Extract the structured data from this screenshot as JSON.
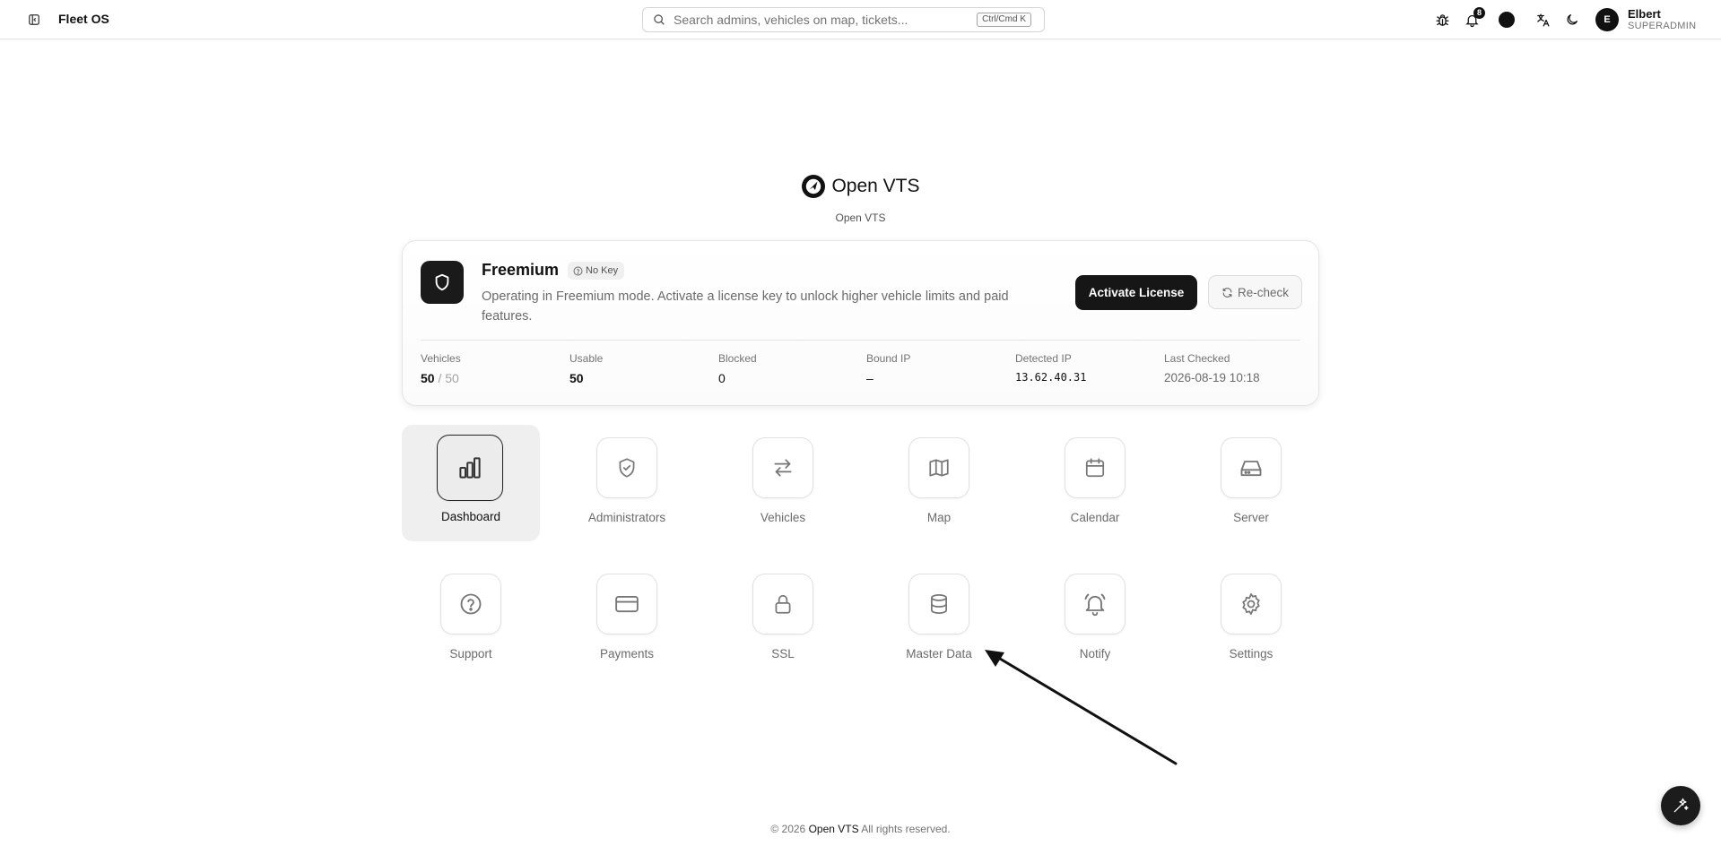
{
  "topbar": {
    "brand": "Fleet OS",
    "sidebar_toggle_icon": "panel-toggle-icon",
    "search": {
      "placeholder": "Search admins, vehicles on map, tickets...",
      "value": "",
      "shortcut": "Ctrl/Cmd K"
    },
    "icons": [
      "bug-icon",
      "bell-icon",
      "theme-color-icon",
      "translate-icon",
      "moon-icon"
    ],
    "notification_count": "8",
    "user": {
      "initial": "E",
      "name": "Elbert",
      "role": "SUPERADMIN"
    }
  },
  "logo": {
    "text": "Open VTS",
    "subtitle": "Open VTS"
  },
  "license": {
    "plan": "Freemium",
    "badge": "No Key",
    "description": "Operating in Freemium mode. Activate a license key to unlock higher vehicle limits and paid features.",
    "activate_label": "Activate License",
    "recheck_label": "Re-check",
    "stats": {
      "vehicles": {
        "label": "Vehicles",
        "value": "50",
        "separator": " / ",
        "limit": "50"
      },
      "usable": {
        "label": "Usable",
        "value": "50"
      },
      "blocked": {
        "label": "Blocked",
        "value": "0"
      },
      "bound_ip": {
        "label": "Bound IP",
        "value": "–"
      },
      "detected_ip": {
        "label": "Detected IP",
        "value": "13.62.40.31"
      },
      "last_checked": {
        "label": "Last Checked",
        "value": "2026-08-19 10:18"
      }
    }
  },
  "apps": [
    {
      "label": "Dashboard",
      "icon": "bar-chart-icon",
      "active": true
    },
    {
      "label": "Administrators",
      "icon": "shield-check-icon"
    },
    {
      "label": "Vehicles",
      "icon": "arrows-left-right-icon"
    },
    {
      "label": "Map",
      "icon": "map-icon"
    },
    {
      "label": "Calendar",
      "icon": "calendar-icon"
    },
    {
      "label": "Server",
      "icon": "hard-drive-icon"
    },
    {
      "label": "Support",
      "icon": "help-circle-icon"
    },
    {
      "label": "Payments",
      "icon": "credit-card-icon"
    },
    {
      "label": "SSL",
      "icon": "lock-icon"
    },
    {
      "label": "Master Data",
      "icon": "database-icon"
    },
    {
      "label": "Notify",
      "icon": "bell-ring-icon"
    },
    {
      "label": "Settings",
      "icon": "gear-icon"
    }
  ],
  "footer": {
    "prefix": "© 2026",
    "brand": "Open VTS",
    "suffix": "All rights reserved."
  }
}
